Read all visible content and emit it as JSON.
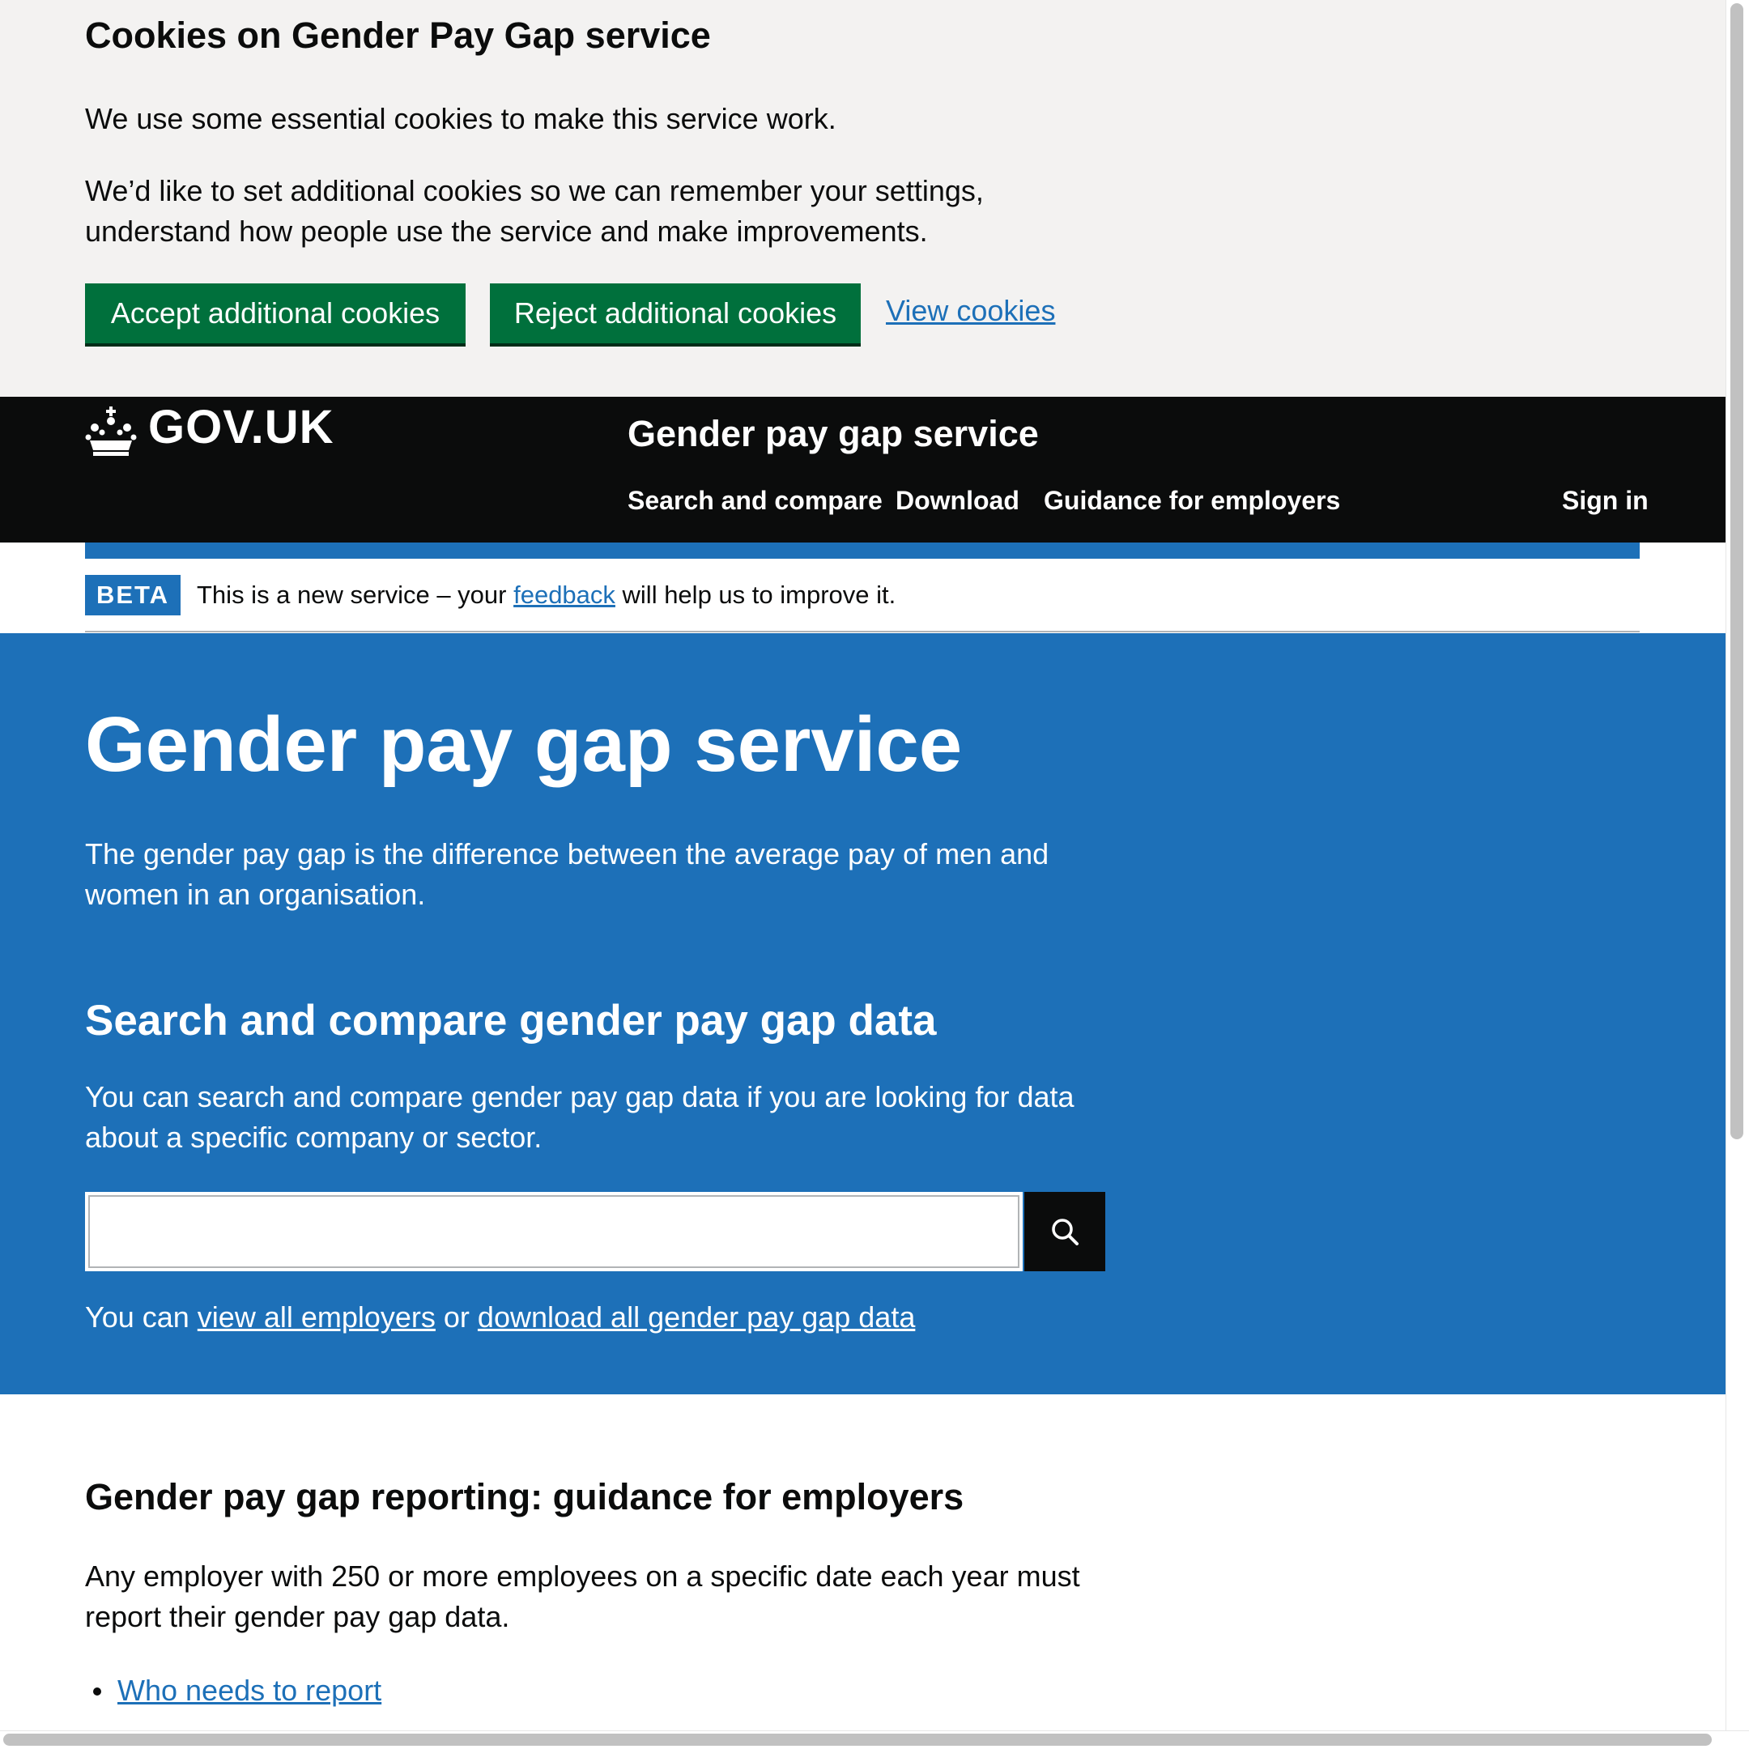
{
  "cookie_banner": {
    "title": "Cookies on Gender Pay Gap service",
    "paragraph_1": "We use some essential cookies to make this service work.",
    "paragraph_2": "We’d like to set additional cookies so we can remember your settings, understand how people use the service and make improvements.",
    "accept_label": "Accept additional cookies",
    "reject_label": "Reject additional cookies",
    "view_label": "View cookies"
  },
  "header": {
    "logo_text": "GOV.UK",
    "service_name": "Gender pay gap service",
    "nav": {
      "search": "Search and compare",
      "download": "Download",
      "guidance": "Guidance for employers",
      "sign_in": "Sign in"
    }
  },
  "beta": {
    "tag": "BETA",
    "text_before": "This is a new service – your ",
    "link": "feedback",
    "text_after": " will help us to improve it."
  },
  "hero": {
    "title": "Gender pay gap service",
    "lead": "The gender pay gap is the difference between the average pay of men and women in an organisation.",
    "search_heading": "Search and compare gender pay gap data",
    "search_text": "You can search and compare gender pay gap data if you are looking for data about a specific company or sector.",
    "search_value": "",
    "links_prefix": "You can ",
    "link_view_all": "view all employers",
    "links_or": " or ",
    "link_download_all": "download all gender pay gap data"
  },
  "guidance": {
    "heading": "Gender pay gap reporting: guidance for employers",
    "paragraph": "Any employer with 250 or more employees on a specific date each year must report their gender pay gap data.",
    "items": [
      "Who needs to report"
    ]
  },
  "colors": {
    "gov_blue": "#1d70b8",
    "button_green": "#00703c",
    "header_black": "#0b0c0c",
    "cookie_grey": "#f3f2f1"
  }
}
